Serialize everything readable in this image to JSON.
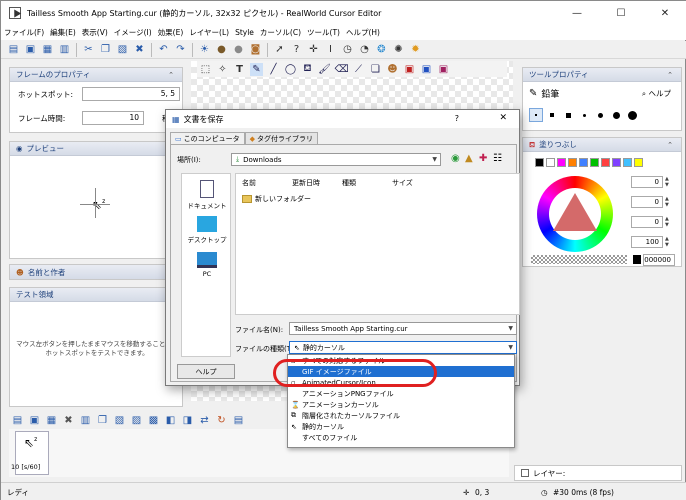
{
  "window": {
    "title": "Tailless Smooth App Starting.cur (静的カーソル, 32x32 ピクセル) - RealWorld Cursor Editor",
    "min": "—",
    "max": "☐",
    "close": "✕"
  },
  "menu": [
    "ファイル(F)",
    "編集(E)",
    "表示(V)",
    "イメージ(I)",
    "効果(E)",
    "レイヤー(L)",
    "Style",
    "カーソル(C)",
    "ツール(T)",
    "ヘルプ(H)"
  ],
  "left": {
    "frame_props_title": "フレームのプロパティ",
    "hotspot_label": "ホットスポット:",
    "hotspot_value": "5, 5",
    "frame_time_label": "フレーム時間:",
    "frame_time_value": "10",
    "frame_time_unit": "秒/",
    "preview_title": "プレビュー",
    "name_author_title": "名前と作者",
    "test_area_title": "テスト領域",
    "test_area_text": "マウス左ボタンを押したままマウスを移動することで、ホットスポットをテストできます。"
  },
  "right": {
    "tool_props_title": "ツールプロパティ",
    "tool_name": "鉛筆",
    "help_label": "ヘルプ",
    "fill_title": "塗りつぶし",
    "values": [
      "0",
      "0",
      "0",
      "100"
    ],
    "hex_value": "000000",
    "swatch_colors": [
      "#000000",
      "#ffffff",
      "#ff00ff",
      "#ff8000",
      "#4080ff",
      "#00c000",
      "#ff4040",
      "#8040ff",
      "#40c0ff",
      "#ffff00"
    ],
    "layers_label": "レイヤー:"
  },
  "dialog": {
    "title": "文書を保存",
    "help_q": "?",
    "close": "✕",
    "tab_computer": "このコンピュータ",
    "tab_library": "タグ付ライブラリ",
    "location_label": "場所(I):",
    "location_value": "Downloads",
    "places": [
      "ドキュメント",
      "デスクトップ",
      "PC"
    ],
    "columns": [
      "名前",
      "更新日時",
      "種類",
      "サイズ"
    ],
    "folder": "新しいフォルダー",
    "filename_label": "ファイル名(N):",
    "filename_value": "Tailless Smooth App Starting.cur",
    "filetype_label": "ファイルの種類(T):",
    "filetype_value": "静的カーソル",
    "help_button": "ヘルプ"
  },
  "dropdown": {
    "items": [
      "すべての対応するファイル",
      "GIF イメージファイル",
      "AnimatedCursor/Icon",
      "アニメーションPNGファイル",
      "アニメーションカーソル",
      "階層化されたカーソルファイル",
      "静的カーソル",
      "すべてのファイル"
    ],
    "selected_index": 1
  },
  "bottom": {
    "frame_label": "10 [s/60]"
  },
  "status": {
    "left": "レディ",
    "coords": "0, 3",
    "zoom": "#30 0ms (8 fps)"
  }
}
